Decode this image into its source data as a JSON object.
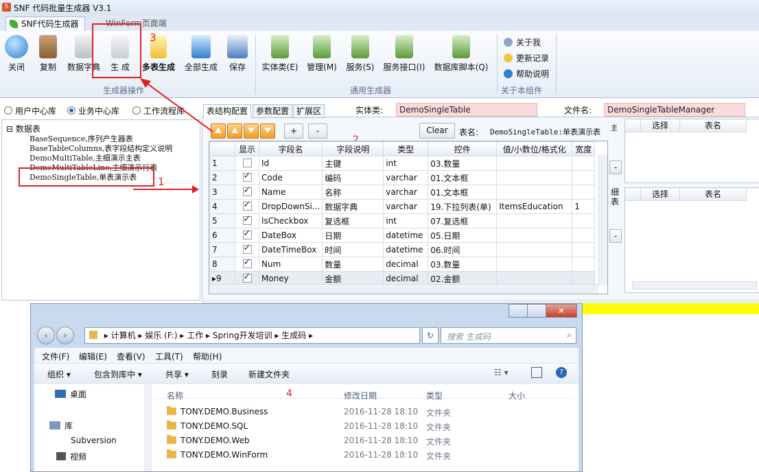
{
  "window": {
    "title": "SNF 代码批量生成器 V3.1",
    "logo_text": "S"
  },
  "tabs": [
    {
      "label": "SNF代码生成器"
    },
    {
      "label": "WinForm页面端"
    }
  ],
  "ribbon": {
    "buttons": [
      {
        "label": "关闭"
      },
      {
        "label": "复制"
      },
      {
        "label": "数据字典"
      },
      {
        "label": "生 成"
      },
      {
        "label": "多表生成"
      },
      {
        "label": "全部生成"
      },
      {
        "label": "保存"
      },
      {
        "label": "实体类(E)"
      },
      {
        "label": "管理(M)"
      },
      {
        "label": "服务(S)"
      },
      {
        "label": "服务接口(I)"
      },
      {
        "label": "数据库脚本(Q)"
      }
    ],
    "groups": [
      "生成器操作",
      "通用生成器",
      "关于本组件"
    ],
    "side_items": [
      {
        "label": "关于我"
      },
      {
        "label": "更新记录"
      },
      {
        "label": "帮助说明"
      }
    ]
  },
  "annotations": [
    "1",
    "2",
    "3",
    "4"
  ],
  "db_radios": [
    {
      "label": "用户中心库",
      "selected": false
    },
    {
      "label": "业务中心库",
      "selected": true
    },
    {
      "label": "工作流程库",
      "selected": false
    }
  ],
  "tree": {
    "root": "数据表",
    "items": [
      "BaseSequence,序列产生器表",
      "BaseTableColumns,表字段结构定义说明",
      "DemoMultiTable,主细演示主表",
      "DemoMultiTableLine,主细演示行表",
      "DemoSingleTable,单表演示表"
    ]
  },
  "inner_tabs": [
    "表结构配置",
    "参数配置",
    "扩展区"
  ],
  "form": {
    "entity_label": "实体类:",
    "entity_value": "DemoSingleTable",
    "file_label": "文件名:",
    "file_value": "DemoSingleTableManager",
    "clear_label": "Clear",
    "add_label": "+",
    "remove_label": "-",
    "table_name_label": "表名:",
    "table_name_value": "DemoSingleTable:单表演示表"
  },
  "grid": {
    "headers": [
      "显示",
      "字段名",
      "字段说明",
      "类型",
      "控件",
      "值/小数位/格式化",
      "宽度"
    ],
    "rows": [
      {
        "num": "1",
        "show": false,
        "field": "Id",
        "desc": "主键",
        "type": "int",
        "control": "03.数量",
        "fmt": "",
        "width": ""
      },
      {
        "num": "2",
        "show": true,
        "field": "Code",
        "desc": "编码",
        "type": "varchar",
        "control": "01.文本框",
        "fmt": "",
        "width": ""
      },
      {
        "num": "3",
        "show": true,
        "field": "Name",
        "desc": "名称",
        "type": "varchar",
        "control": "01.文本框",
        "fmt": "",
        "width": ""
      },
      {
        "num": "4",
        "show": true,
        "field": "DropDownSi...",
        "desc": "数据字典",
        "type": "varchar",
        "control": "19.下拉列表(单)",
        "fmt": "ItemsEducation",
        "width": "1"
      },
      {
        "num": "5",
        "show": true,
        "field": "IsCheckbox",
        "desc": "复选框",
        "type": "int",
        "control": "07.复选框",
        "fmt": "",
        "width": ""
      },
      {
        "num": "6",
        "show": true,
        "field": "DateBox",
        "desc": "日期",
        "type": "datetime",
        "control": "05.日期",
        "fmt": "",
        "width": ""
      },
      {
        "num": "7",
        "show": true,
        "field": "DateTimeBox",
        "desc": "时间",
        "type": "datetime",
        "control": "06.时间",
        "fmt": "",
        "width": ""
      },
      {
        "num": "8",
        "show": true,
        "field": "Num",
        "desc": "数量",
        "type": "decimal",
        "control": "03.数量",
        "fmt": "",
        "width": ""
      },
      {
        "num": "9",
        "show": true,
        "field": "Money",
        "desc": "金额",
        "type": "decimal",
        "control": "02.金额",
        "fmt": "",
        "width": ""
      }
    ]
  },
  "right_panel": {
    "headers": [
      "选择",
      "表名"
    ],
    "detail_label": "细表",
    "minus_label": "-"
  },
  "explorer": {
    "breadcrumb": [
      "计算机",
      "娱乐 (F:)",
      "工作",
      "Spring开发培训",
      "生成码"
    ],
    "search_placeholder": "搜索 生成码",
    "menu": [
      "文件(F)",
      "编辑(E)",
      "查看(V)",
      "工具(T)",
      "帮助(H)"
    ],
    "toolbar": [
      "组织 ▾",
      "包含到库中 ▾",
      "共享 ▾",
      "刻录",
      "新建文件夹"
    ],
    "nav": [
      "桌面",
      "库",
      "Subversion",
      "视频"
    ],
    "columns": [
      "名称",
      "修改日期",
      "类型",
      "大小"
    ],
    "files": [
      {
        "name": "TONY.DEMO.Business",
        "date": "2016-11-28 18:10",
        "type": "文件夹"
      },
      {
        "name": "TONY.DEMO.SQL",
        "date": "2016-11-28 18:10",
        "type": "文件夹"
      },
      {
        "name": "TONY.DEMO.Web",
        "date": "2016-11-28 18:10",
        "type": "文件夹"
      },
      {
        "name": "TONY.DEMO.WinForm",
        "date": "2016-11-28 18:10",
        "type": "文件夹"
      }
    ]
  }
}
